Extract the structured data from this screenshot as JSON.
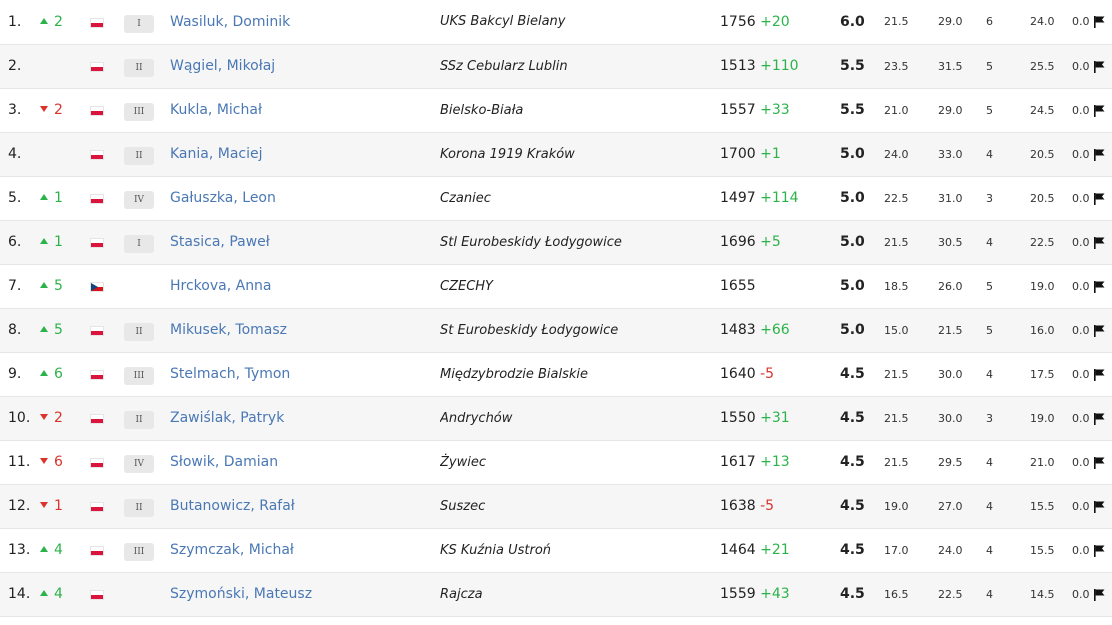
{
  "rows": [
    {
      "rank": "1.",
      "dir": "up",
      "change": "2",
      "flag": "pl",
      "cat": "I",
      "name": "Wasiluk, Dominik",
      "club": "UKS Bakcyl Bielany",
      "rating": "1756",
      "rchg": "+20",
      "pts": "6.0",
      "tb1": "21.5",
      "tb2": "29.0",
      "tb3": "6",
      "tb4": "24.0",
      "tb5": "0.0"
    },
    {
      "rank": "2.",
      "dir": "",
      "change": "",
      "flag": "pl",
      "cat": "II",
      "name": "Wągiel, Mikołaj",
      "club": "SSz Cebularz Lublin",
      "rating": "1513",
      "rchg": "+110",
      "pts": "5.5",
      "tb1": "23.5",
      "tb2": "31.5",
      "tb3": "5",
      "tb4": "25.5",
      "tb5": "0.0"
    },
    {
      "rank": "3.",
      "dir": "down",
      "change": "2",
      "flag": "pl",
      "cat": "III",
      "name": "Kukla, Michał",
      "club": "Bielsko-Biała",
      "rating": "1557",
      "rchg": "+33",
      "pts": "5.5",
      "tb1": "21.0",
      "tb2": "29.0",
      "tb3": "5",
      "tb4": "24.5",
      "tb5": "0.0"
    },
    {
      "rank": "4.",
      "dir": "",
      "change": "",
      "flag": "pl",
      "cat": "II",
      "name": "Kania, Maciej",
      "club": "Korona 1919 Kraków",
      "rating": "1700",
      "rchg": "+1",
      "pts": "5.0",
      "tb1": "24.0",
      "tb2": "33.0",
      "tb3": "4",
      "tb4": "20.5",
      "tb5": "0.0"
    },
    {
      "rank": "5.",
      "dir": "up",
      "change": "1",
      "flag": "pl",
      "cat": "IV",
      "name": "Gałuszka, Leon",
      "club": "Czaniec",
      "rating": "1497",
      "rchg": "+114",
      "pts": "5.0",
      "tb1": "22.5",
      "tb2": "31.0",
      "tb3": "3",
      "tb4": "20.5",
      "tb5": "0.0"
    },
    {
      "rank": "6.",
      "dir": "up",
      "change": "1",
      "flag": "pl",
      "cat": "I",
      "name": "Stasica, Paweł",
      "club": "Stl Eurobeskidy Łodygowice",
      "rating": "1696",
      "rchg": "+5",
      "pts": "5.0",
      "tb1": "21.5",
      "tb2": "30.5",
      "tb3": "4",
      "tb4": "22.5",
      "tb5": "0.0"
    },
    {
      "rank": "7.",
      "dir": "up",
      "change": "5",
      "flag": "cz",
      "cat": "",
      "name": "Hrckova, Anna",
      "club": "CZECHY",
      "rating": "1655",
      "rchg": "",
      "pts": "5.0",
      "tb1": "18.5",
      "tb2": "26.0",
      "tb3": "5",
      "tb4": "19.0",
      "tb5": "0.0"
    },
    {
      "rank": "8.",
      "dir": "up",
      "change": "5",
      "flag": "pl",
      "cat": "II",
      "name": "Mikusek, Tomasz",
      "club": "St Eurobeskidy Łodygowice",
      "rating": "1483",
      "rchg": "+66",
      "pts": "5.0",
      "tb1": "15.0",
      "tb2": "21.5",
      "tb3": "5",
      "tb4": "16.0",
      "tb5": "0.0"
    },
    {
      "rank": "9.",
      "dir": "up",
      "change": "6",
      "flag": "pl",
      "cat": "III",
      "name": "Stelmach, Tymon",
      "club": "Międzybrodzie Bialskie",
      "rating": "1640",
      "rchg": "-5",
      "pts": "4.5",
      "tb1": "21.5",
      "tb2": "30.0",
      "tb3": "4",
      "tb4": "17.5",
      "tb5": "0.0"
    },
    {
      "rank": "10.",
      "dir": "down",
      "change": "2",
      "flag": "pl",
      "cat": "II",
      "name": "Zawiślak, Patryk",
      "club": "Andrychów",
      "rating": "1550",
      "rchg": "+31",
      "pts": "4.5",
      "tb1": "21.5",
      "tb2": "30.0",
      "tb3": "3",
      "tb4": "19.0",
      "tb5": "0.0"
    },
    {
      "rank": "11.",
      "dir": "down",
      "change": "6",
      "flag": "pl",
      "cat": "IV",
      "name": "Słowik, Damian",
      "club": "Żywiec",
      "rating": "1617",
      "rchg": "+13",
      "pts": "4.5",
      "tb1": "21.5",
      "tb2": "29.5",
      "tb3": "4",
      "tb4": "21.0",
      "tb5": "0.0"
    },
    {
      "rank": "12.",
      "dir": "down",
      "change": "1",
      "flag": "pl",
      "cat": "II",
      "name": "Butanowicz, Rafał",
      "club": "Suszec",
      "rating": "1638",
      "rchg": "-5",
      "pts": "4.5",
      "tb1": "19.0",
      "tb2": "27.0",
      "tb3": "4",
      "tb4": "15.5",
      "tb5": "0.0"
    },
    {
      "rank": "13.",
      "dir": "up",
      "change": "4",
      "flag": "pl",
      "cat": "III",
      "name": "Szymczak, Michał",
      "club": "KS Kuźnia Ustroń",
      "rating": "1464",
      "rchg": "+21",
      "pts": "4.5",
      "tb1": "17.0",
      "tb2": "24.0",
      "tb3": "4",
      "tb4": "15.5",
      "tb5": "0.0"
    },
    {
      "rank": "14.",
      "dir": "up",
      "change": "4",
      "flag": "pl",
      "cat": "",
      "name": "Szymoński, Mateusz",
      "club": "Rajcza",
      "rating": "1559",
      "rchg": "+43",
      "pts": "4.5",
      "tb1": "16.5",
      "tb2": "22.5",
      "tb3": "4",
      "tb4": "14.5",
      "tb5": "0.0"
    }
  ],
  "colors": {
    "up": "#2bb34a",
    "down": "#d9332b",
    "link": "#4a78b5"
  }
}
